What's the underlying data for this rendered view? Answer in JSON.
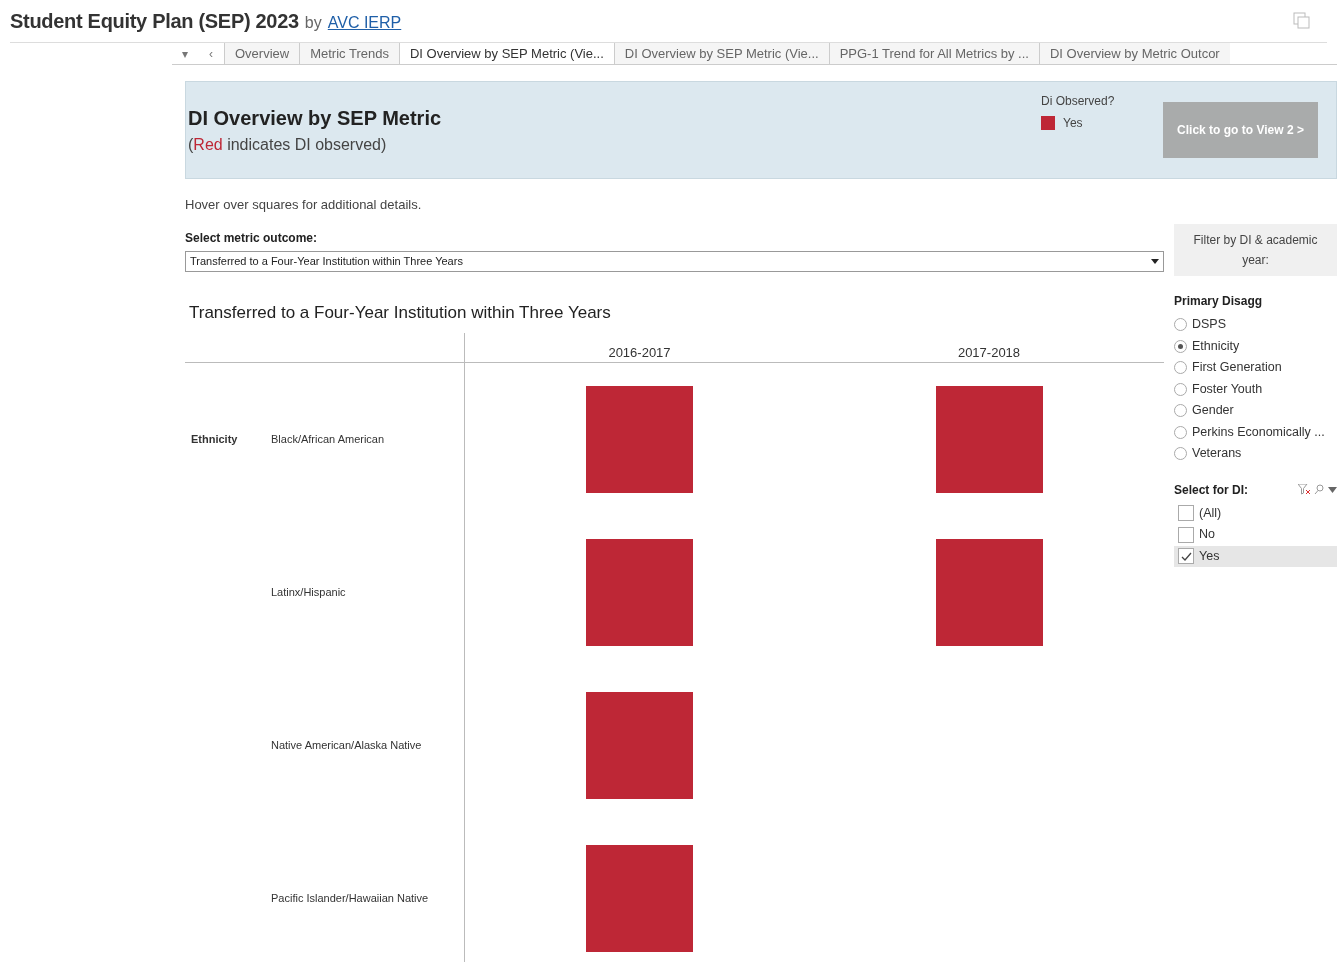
{
  "header": {
    "title": "Student Equity Plan (SEP) 2023",
    "by": "by",
    "author": "AVC IERP"
  },
  "tab_controls": [
    "▾",
    "‹"
  ],
  "tabs": [
    {
      "label": "Overview",
      "selected": false
    },
    {
      "label": "Metric Trends",
      "selected": false
    },
    {
      "label": "DI Overview by SEP Metric (Vie...",
      "selected": true
    },
    {
      "label": "DI Overview by SEP Metric (Vie...",
      "selected": false
    },
    {
      "label": "PPG-1 Trend for All Metrics by ...",
      "selected": false
    },
    {
      "label": "DI Overview by Metric Outcor",
      "selected": false
    }
  ],
  "banner": {
    "title": "DI Overview by SEP Metric",
    "subtitle": {
      "prefix": "(",
      "highlight": "Red",
      "suffix": " indicates DI observed)"
    },
    "legend_title": "Di Observed?",
    "legend_items": [
      {
        "label": "Yes",
        "color": "#be2736"
      }
    ],
    "button": "Click to go to View 2 >"
  },
  "hint": "Hover over squares for additional details.",
  "metric_select": {
    "label": "Select metric outcome:",
    "value": "Transferred to a Four-Year Institution within Three Years"
  },
  "chart": {
    "title": "Transferred to a Four-Year Institution within Three Years",
    "columns": [
      "2016-2017",
      "2017-2018"
    ],
    "rows": [
      {
        "group": "Ethnicity",
        "label": "Black/African American",
        "di": [
          true,
          true
        ]
      },
      {
        "group": "",
        "label": "Latinx/Hispanic",
        "di": [
          true,
          true
        ]
      },
      {
        "group": "",
        "label": "Native American/Alaska Native",
        "di": [
          true,
          false
        ]
      },
      {
        "group": "",
        "label": "Pacific Islander/Hawaiian Native",
        "di": [
          true,
          false
        ]
      }
    ]
  },
  "filter_panel": {
    "title": "Filter by DI & academic year:",
    "primary_disagg": {
      "label": "Primary Disagg",
      "options": [
        {
          "label": "DSPS",
          "selected": false
        },
        {
          "label": "Ethnicity",
          "selected": true
        },
        {
          "label": "First Generation",
          "selected": false
        },
        {
          "label": "Foster Youth",
          "selected": false
        },
        {
          "label": "Gender",
          "selected": false
        },
        {
          "label": "Perkins Economically ...",
          "selected": false
        },
        {
          "label": "Veterans",
          "selected": false
        }
      ]
    },
    "select_di": {
      "label": "Select for DI:",
      "options": [
        {
          "label": "(All)",
          "checked": false
        },
        {
          "label": "No",
          "checked": false
        },
        {
          "label": "Yes",
          "checked": true
        }
      ]
    }
  }
}
